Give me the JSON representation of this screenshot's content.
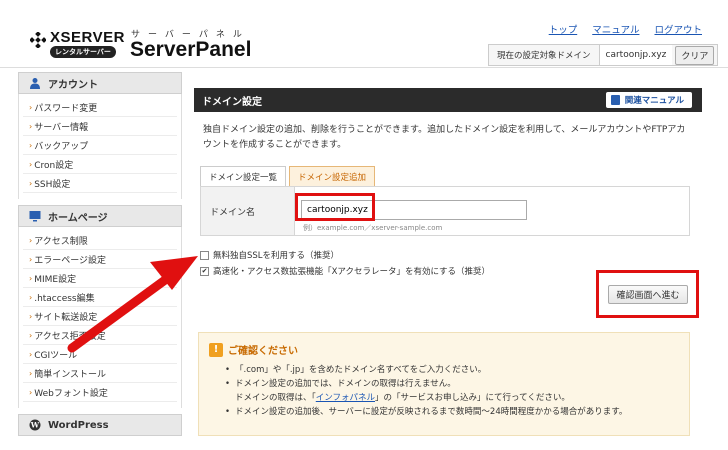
{
  "header": {
    "logo_text": "XSERVER",
    "logo_sub": "レンタルサーバー",
    "panel_kana": "サーバーパネル",
    "panel_title": "ServerPanel",
    "links": [
      "トップ",
      "マニュアル",
      "ログアウト"
    ],
    "current_domain_label": "現在の設定対象ドメイン",
    "current_domain": "cartoonjp.xyz",
    "clear_label": "クリア"
  },
  "sidebar": {
    "sections": [
      {
        "title": "アカウント",
        "items": [
          "パスワード変更",
          "サーバー情報",
          "バックアップ",
          "Cron設定",
          "SSH設定"
        ]
      },
      {
        "title": "ホームページ",
        "items": [
          "アクセス制限",
          "エラーページ設定",
          "MIME設定",
          ".htaccess編集",
          "サイト転送設定",
          "アクセス拒否設定",
          "CGIツール",
          "簡単インストール",
          "Webフォント設定"
        ]
      },
      {
        "title": "WordPress",
        "items": []
      }
    ]
  },
  "main": {
    "title": "ドメイン設定",
    "manual_label": "関連マニュアル",
    "description": "独自ドメイン設定の追加、削除を行うことができます。追加したドメイン設定を利用して、メールアカウントやFTPアカウントを作成することができます。",
    "tabs": [
      "ドメイン設定一覧",
      "ドメイン設定追加"
    ],
    "form": {
      "label": "ドメイン名",
      "value": "cartoonjp.xyz",
      "example": "例）example.com／xserver-sample.com"
    },
    "options": [
      {
        "label": "無料独自SSLを利用する（推奨）",
        "checked": false
      },
      {
        "label": "高速化・アクセス数拡張機能「Xアクセラレータ」を有効にする（推奨）",
        "checked": true
      }
    ],
    "confirm_label": "確認画面へ進む",
    "notice": {
      "title": "ご確認ください",
      "item1": "「.com」や「.jp」を含めたドメイン名すべてをご入力ください。",
      "item2": "ドメイン設定の追加では、ドメインの取得は行えません。",
      "item3_pre": "ドメインの取得は、「",
      "item3_link": "インフォパネル",
      "item3_post": "」の「サービスお申し込み」にて行ってください。",
      "item4": "ドメイン設定の追加後、サーバーに設定が反映されるまで数時間〜24時間程度かかる場合があります。"
    }
  },
  "colors": {
    "accent_red": "#e01010",
    "title_bar": "#2b2b2b",
    "link_blue": "#1a55b3",
    "active_tab": "#c66500"
  }
}
